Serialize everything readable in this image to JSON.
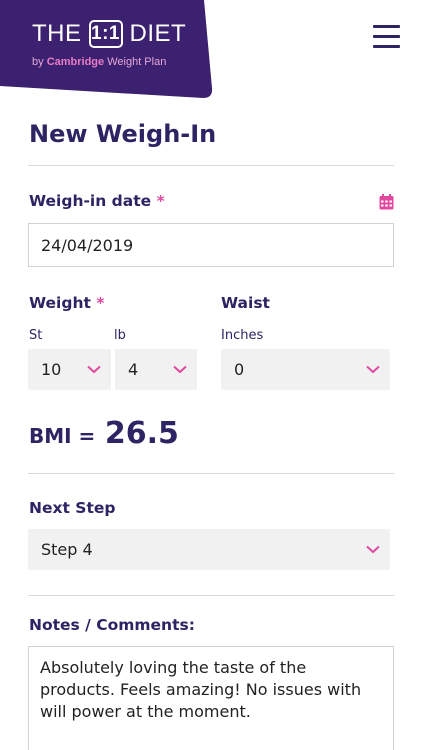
{
  "header": {
    "logo_prefix": "THE",
    "logo_mark": "1:1",
    "logo_suffix": "DIET",
    "logo_sub_by": "by",
    "logo_sub_brand": "Cambridge",
    "logo_sub_rest": "Weight Plan",
    "brand_color": "#3b2170",
    "menu_icon": "hamburger-icon"
  },
  "page": {
    "title": "New Weigh-In"
  },
  "weigh_in_date": {
    "label": "Weigh-in date",
    "required_mark": "*",
    "value": "24/04/2019",
    "icon": "calendar-icon"
  },
  "weight": {
    "label": "Weight",
    "required_mark": "*",
    "st_label": "St",
    "lb_label": "lb",
    "st_value": "10",
    "lb_value": "4"
  },
  "waist": {
    "label": "Waist",
    "unit_label": "Inches",
    "value": "0"
  },
  "bmi": {
    "label": "BMI =",
    "value": "26.5"
  },
  "next_step": {
    "label": "Next Step",
    "value": "Step 4"
  },
  "notes": {
    "label": "Notes / Comments:",
    "value": "Absolutely loving the taste of the products. Feels amazing! No issues with will power at the moment."
  },
  "colors": {
    "accent": "#e0499f",
    "text_primary": "#2d2463",
    "select_bg": "#f1f1f1"
  }
}
